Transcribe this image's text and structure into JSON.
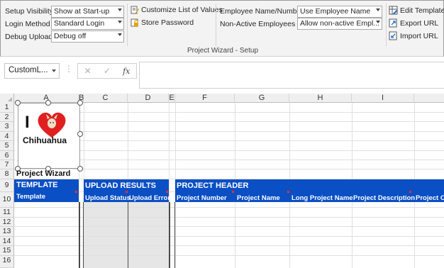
{
  "ribbon": {
    "setup_visibility": {
      "label": "Setup Visibility",
      "value": "Show at Start-up"
    },
    "login_method": {
      "label": "Login Method",
      "value": "Standard Login"
    },
    "debug_upload": {
      "label": "Debug Upload",
      "value": "Debug off"
    },
    "customize_list": "Customize List of Values",
    "store_password": "Store Password",
    "employee_name_number": {
      "label": "Employee Name/Number",
      "value": "Use Employee Name"
    },
    "non_active_employees": {
      "label": "Non-Active Employees",
      "value": "Allow non-active Empl..."
    },
    "edit_template": "Edit Template",
    "export_url": "Export URL",
    "import_url": "Import URL",
    "group_label": "Project Wizard - Setup"
  },
  "formula_bar": {
    "name_box": "CustomL...",
    "fx": "fx",
    "cancel": "✕",
    "enter": "✓"
  },
  "columns": [
    "A",
    "B",
    "C",
    "D",
    "E",
    "F",
    "G",
    "H",
    "I"
  ],
  "rows": [
    "1",
    "2",
    "3",
    "4",
    "5",
    "6",
    "7",
    "8",
    "9",
    "10",
    "11",
    "12",
    "13",
    "14",
    "15",
    "16"
  ],
  "logo": {
    "letter": "I",
    "text": "Chihuahua"
  },
  "sheet": {
    "wizard_label": "Project Wizard",
    "template": {
      "title": "TEMPLATE",
      "sub": "Template"
    },
    "upload_results": {
      "title": "UPLOAD RESULTS",
      "subs": [
        "Upload Status",
        "Upload Error"
      ]
    },
    "project_header": {
      "title": "PROJECT HEADER",
      "subs": [
        "Project Number",
        "Project Name",
        "Long Project Name",
        "Project Description",
        "Project O"
      ]
    }
  },
  "colors": {
    "band": "#0b4fc4",
    "heart": "#e02020",
    "gray_columns": "#e6e6e6"
  }
}
